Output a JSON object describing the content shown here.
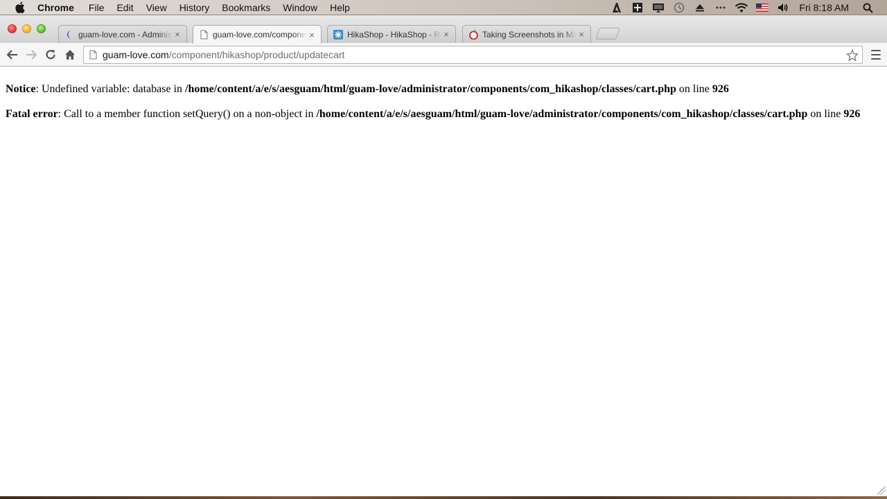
{
  "menubar": {
    "app_name": "Chrome",
    "items": [
      "File",
      "Edit",
      "View",
      "History",
      "Bookmarks",
      "Window",
      "Help"
    ],
    "clock": "Fri 8:18 AM",
    "status_icons": [
      "adobe-icon",
      "evernote-icon",
      "display-icon",
      "time-machine-icon",
      "eject-icon",
      "overflow-dots-icon",
      "wifi-icon",
      "us-flag-icon",
      "volume-icon",
      "spotlight-icon"
    ]
  },
  "tabs": [
    {
      "title": "guam-love.com - Administration",
      "favicon": "joomla-icon",
      "active": false
    },
    {
      "title": "guam-love.com/component/hikashop/product/updatecart",
      "favicon": "page-icon",
      "active": true
    },
    {
      "title": "HikaShop - HikaShop - Report",
      "favicon": "hikashop-icon",
      "active": false
    },
    {
      "title": "Taking Screenshots in Mac OS X",
      "favicon": "apple-red-icon",
      "active": false
    }
  ],
  "tab_close": "×",
  "omnibox": {
    "host": "guam-love.com",
    "path": "/component/hikashop/product/updatecart"
  },
  "errors": [
    {
      "label": "Notice",
      "message": ": Undefined variable: database in ",
      "file": "/home/content/a/e/s/aesguam/html/guam-love/administrator/components/com_hikashop/classes/cart.php",
      "on_line": " on line ",
      "line": "926"
    },
    {
      "label": "Fatal error",
      "message": ": Call to a member function setQuery() on a non-object in ",
      "file": "/home/content/a/e/s/aesguam/html/guam-love/administrator/components/com_hikashop/classes/cart.php",
      "on_line": " on line ",
      "line": "926"
    }
  ]
}
